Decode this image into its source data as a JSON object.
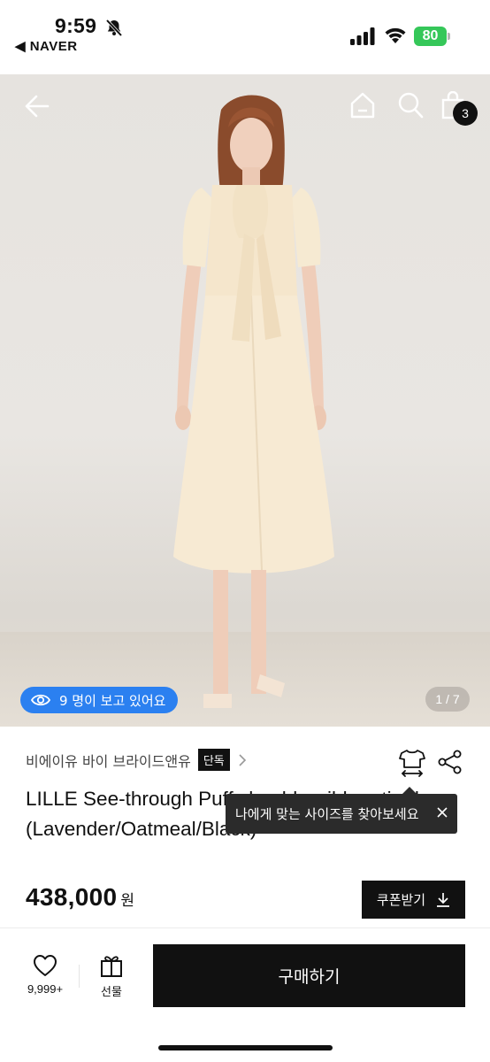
{
  "status_bar": {
    "time": "9:59",
    "back_app": "◀ NAVER",
    "battery": "80",
    "battery_color": "#35c759"
  },
  "hero": {
    "icons": [
      "back-arrow-icon",
      "home-icon",
      "search-icon",
      "shopping-bag-icon"
    ],
    "cart_count": "3",
    "viewer_text": "9 명이 보고 있어요",
    "viewer_color": "#2b80f0",
    "image_counter": "1 / 7"
  },
  "product": {
    "brand": "비에이유 바이 브라이드앤유",
    "exclusive_badge": "단독",
    "title": "LILLE See-through Puff shoulder ribbon tie dress (Lavender/Oatmeal/Black)",
    "price": "438,000",
    "currency": "원",
    "coupon_label": "쿠폰받기"
  },
  "tooltip": {
    "text": "나에게 맞는 사이즈를 찾아보세요"
  },
  "bottom_bar": {
    "like_count": "9,999+",
    "gift_label": "선물",
    "buy_label": "구매하기"
  }
}
